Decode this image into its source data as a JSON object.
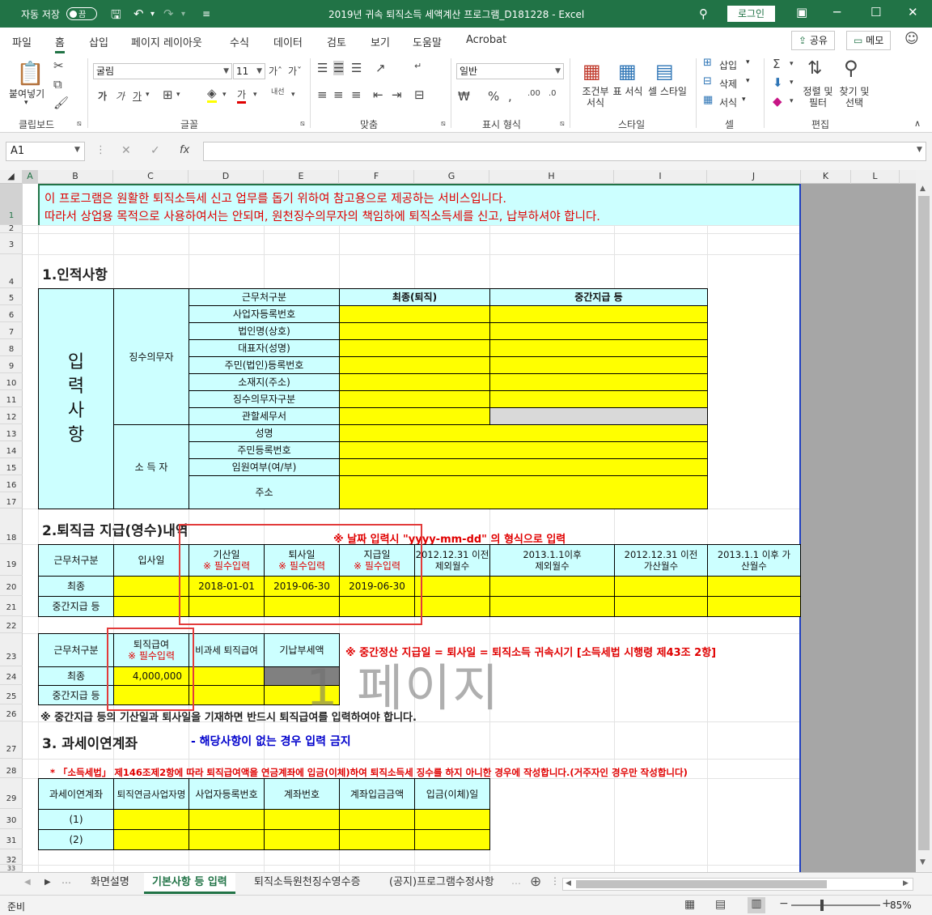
{
  "titlebar": {
    "autosave_label": "자동 저장",
    "autosave_state": "끔",
    "filename": "2019년 귀속 퇴직소득 세액계산 프로그램_D181228  -  Excel",
    "login": "로그인"
  },
  "ribbon_tabs": [
    "파일",
    "홈",
    "삽입",
    "페이지 레이아웃",
    "수식",
    "데이터",
    "검토",
    "보기",
    "도움말",
    "Acrobat"
  ],
  "share_label": "공유",
  "memo_label": "메모",
  "ribbon": {
    "paste": "붙여넣기",
    "clipboard": "클립보드",
    "font_name": "굴림",
    "font_size": "11",
    "font_group": "글꼴",
    "align_group": "맞춤",
    "number_format": "일반",
    "number_group": "표시 형식",
    "cond_format": "조건부 서식",
    "table_format": "표 서식",
    "cell_style": "셀 스타일",
    "style_group": "스타일",
    "insert": "삽입",
    "delete": "삭제",
    "format": "서식",
    "cell_group": "셀",
    "sort": "정렬 및 필터",
    "find": "찾기 및 선택",
    "edit_group": "편집",
    "bold": "가",
    "italic": "가",
    "underline": "가",
    "font_color": "가",
    "wrap_text": "내선"
  },
  "namebox": "A1",
  "formula_value": "",
  "columns": [
    "A",
    "B",
    "C",
    "D",
    "E",
    "F",
    "G",
    "H",
    "I",
    "J",
    "K",
    "L"
  ],
  "rows": [
    "1",
    "2",
    "3",
    "4",
    "5",
    "6",
    "7",
    "8",
    "9",
    "10",
    "11",
    "12",
    "13",
    "14",
    "15",
    "16",
    "17",
    "18",
    "19",
    "20",
    "21",
    "22",
    "23",
    "24",
    "25",
    "26",
    "27",
    "28",
    "29",
    "30",
    "31",
    "32",
    "33"
  ],
  "sheet": {
    "notice_line1": "이 프로그램은 원활한 퇴직소득세 신고 업무를 돕기 위하여 참고용으로 제공하는 서비스입니다.",
    "notice_line2": "따라서 상업용 목적으로 사용하여서는 안되며, 원천징수의무자의 책임하에 퇴직소득세를 신고, 납부하셔야 합니다.",
    "section1": "1.인적사항",
    "input_label": "입력사항",
    "withholder": "징수의무자",
    "earner": "소 득 자",
    "hdr_workplace": "근무처구분",
    "hdr_final": "최종(퇴직)",
    "hdr_mid": "중간지급 등",
    "fields_withholder": [
      "사업자등록번호",
      "법인명(상호)",
      "대표자(성명)",
      "주민(법인)등록번호",
      "소재지(주소)",
      "징수의무자구분",
      "관할세무서"
    ],
    "fields_earner": [
      "성명",
      "주민등록번호",
      "임원여부(여/부)",
      "주소"
    ],
    "section2": "2.퇴직금 지급(영수)내역",
    "date_notice": "※ 날짜 입력시 \"yyyy-mm-dd\" 의 형식으로 입력",
    "t2_h_workplace": "근무처구분",
    "t2_h_join": "입사일",
    "t2_h_start": "기산일",
    "t2_h_retire": "퇴사일",
    "t2_h_pay": "지급일",
    "required": "※ 필수입력",
    "t2_h_ex_before": "2012.12.31 이전 제외월수",
    "t2_h_ex_after": "2013.1.1이후 제외월수",
    "t2_h_add_before": "2012.12.31 이전 가산월수",
    "t2_h_add_after": "2013.1.1 이후 가산월수",
    "row_final": "최종",
    "row_mid": "중간지급 등",
    "date_start": "2018-01-01",
    "date_retire": "2019-06-30",
    "date_pay": "2019-06-30",
    "t3_h_workplace": "근무처구분",
    "t3_h_pay": "퇴직급여",
    "t3_h_nontax": "비과세 퇴직급여",
    "t3_h_prepaid": "기납부세액",
    "mid_notice": "※ 중간정산 지급일 = 퇴사일 = 퇴직소득 귀속시기  [소득세법 시행령 제43조 2항]",
    "pay_value": "4,000,000",
    "watermark": "1 페이지",
    "note26": "※ 중간지급 등의 기산일과 퇴사일을 기재하면 반드시 퇴직급여를 입력하여야 합니다.",
    "section3": "3. 과세이연계좌",
    "section3_note": "- 해당사항이 없는 경우 입력 금지",
    "law_note": "* 「소득세법」 제146조제2항에 따라 퇴직급여액을 연금계좌에 입금(이체)하여 퇴직소득세 징수를 하지 아니한 경우에 작성합니다.(거주자인 경우만 작성합니다)",
    "t4_headers": [
      "과세이연계좌",
      "퇴직연금사업자명",
      "사업자등록번호",
      "계좌번호",
      "계좌입금금액",
      "입금(이체)일"
    ],
    "t4_rows": [
      "(1)",
      "(2)"
    ]
  },
  "sheet_tabs": [
    "화면설명",
    "기본사항 등 입력",
    "퇴직소득원천징수영수증",
    "(공지)프로그램수정사항"
  ],
  "active_sheet_tab": "기본사항 등 입력",
  "status": {
    "ready": "준비",
    "zoom": "85%"
  },
  "colors": {
    "excel_green": "#217346",
    "input_yellow": "#ffff00",
    "label_cyan": "#ccffff",
    "notice_red": "#e00000",
    "note_blue": "#0000cc"
  }
}
